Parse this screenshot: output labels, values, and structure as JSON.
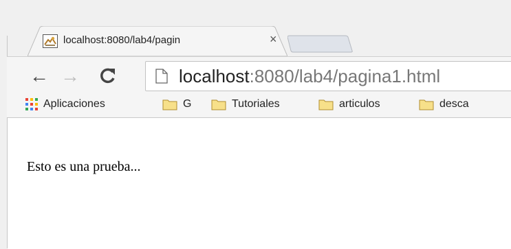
{
  "tab": {
    "title": "localhost:8080/lab4/pagin",
    "close_symbol": "×",
    "favicon": "tomcat-icon"
  },
  "toolbar": {
    "back_symbol": "←",
    "forward_symbol": "→",
    "reload_icon": "reload-icon"
  },
  "omnibox": {
    "url_host": "localhost",
    "url_rest": ":8080/lab4/pagina1.html",
    "page_icon": "page-icon"
  },
  "bookmarks": {
    "items": [
      {
        "label": "Aplicaciones",
        "icon": "apps-grid-icon"
      },
      {
        "label": "G",
        "icon": "folder-icon"
      },
      {
        "label": "Tutoriales",
        "icon": "folder-icon"
      },
      {
        "label": "articulos",
        "icon": "folder-icon"
      },
      {
        "label": "desca",
        "icon": "folder-icon"
      }
    ]
  },
  "content": {
    "text": "Esto es una prueba..."
  }
}
